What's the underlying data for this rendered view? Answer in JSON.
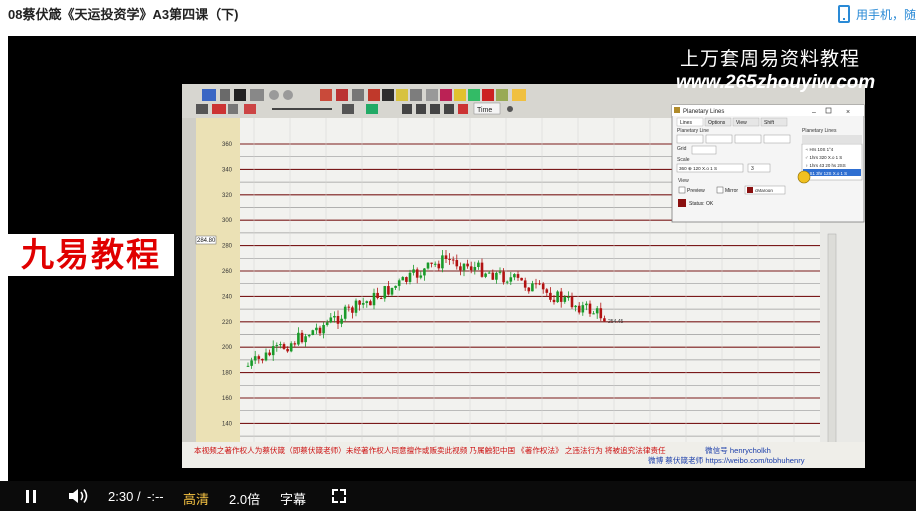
{
  "page": {
    "title": "08蔡伏箴《天运投资学》A3第四课（下)",
    "mobile_link": "用手机，随"
  },
  "video": {
    "watermark_cn": "上万套周易资料教程",
    "watermark_url": "www.265zhouyiw.com",
    "overlay_text": "九易教程",
    "chart": {
      "price_labels": [
        "360",
        "340",
        "320",
        "300",
        "280",
        "260",
        "240",
        "220",
        "200",
        "180",
        "160",
        "140"
      ],
      "current_price_label": "284.80",
      "end_price_label": "254.45",
      "toolbar_dropdown": "Time",
      "bottom_notice": "本视频之著作权人为蔡伏箴（即蔡伏箴老师）未经著作权人同意擅作或贩卖此视频 乃属触犯中国 《著作权法》 之违法行为 将被追究法律责任",
      "contact_weixin": "微信号 henrycholkh",
      "contact_weibo": "微博 蔡伏箴老师 https://weibo.com/tobhuhenry",
      "window": {
        "title": "Planetary Lines",
        "tabs": [
          "Lines",
          "Options",
          "View",
          "Shift"
        ],
        "section_lines": "Planetary Line",
        "section_list": "Planetary Lines",
        "list_items": [
          "♃ Hrs 10S 1°4",
          "♂ 1hrs 320 X.o 1 S",
          "♀ 1hrs 43 20 hs 2SS",
          "♄ S1 3hr 12S X.o 1 S"
        ],
        "grid_label": "Grid",
        "scale_label": "Scale",
        "scale_value": "360 ⊕ 120 X.o 1 S",
        "scale_num": "3",
        "view_label": "View",
        "preview_label": "Preview",
        "mirror_label": "Mirror",
        "color_label": "cMaroon",
        "status": "Status: OK"
      }
    }
  },
  "controls": {
    "time_current": "2:30",
    "time_separator": "/",
    "time_total": "-:--",
    "quality": "高清",
    "speed": "2.0倍",
    "subtitles": "字幕"
  },
  "colors": {
    "accent_blue": "#2a8ad6",
    "quality_gold": "#f6c343",
    "candle_up": "#1a9a2a",
    "candle_down": "#b21212",
    "overlay_red": "#e00000"
  }
}
